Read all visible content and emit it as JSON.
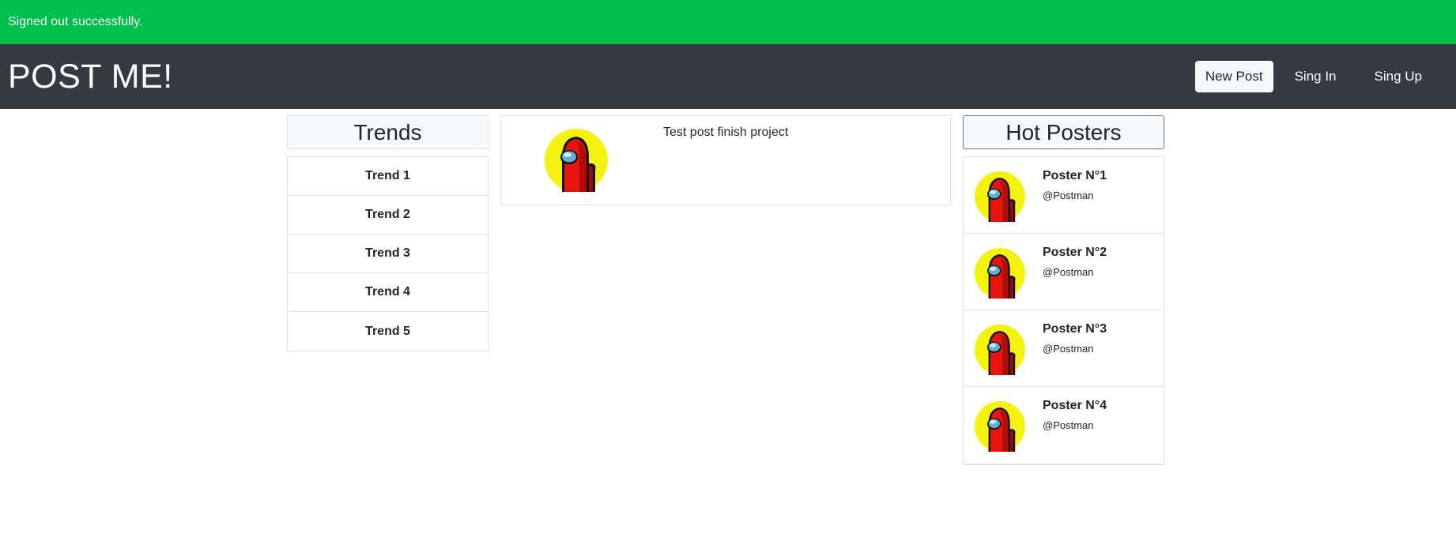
{
  "flash": {
    "message": "Signed out successfully."
  },
  "navbar": {
    "brand": "POST ME!",
    "new_post_label": "New Post",
    "sign_in_label": "Sing In",
    "sign_up_label": "Sing Up"
  },
  "trends": {
    "title": "Trends",
    "items": [
      {
        "label": "Trend 1"
      },
      {
        "label": "Trend 2"
      },
      {
        "label": "Trend 3"
      },
      {
        "label": "Trend 4"
      },
      {
        "label": "Trend 5"
      }
    ]
  },
  "feed": {
    "posts": [
      {
        "text": "Test post finish project",
        "avatar_icon": "crewmate-avatar-icon"
      }
    ]
  },
  "hot_posters": {
    "title": "Hot Posters",
    "items": [
      {
        "name": "Poster N°1",
        "handle": "@Postman"
      },
      {
        "name": "Poster N°2",
        "handle": "@Postman"
      },
      {
        "name": "Poster N°3",
        "handle": "@Postman"
      },
      {
        "name": "Poster N°4",
        "handle": "@Postman"
      }
    ]
  },
  "colors": {
    "flash_bg": "#00c04b",
    "navbar_bg": "#343a40",
    "avatar_bg": "#f5f20f",
    "crewmate_red": "#e8150e"
  }
}
